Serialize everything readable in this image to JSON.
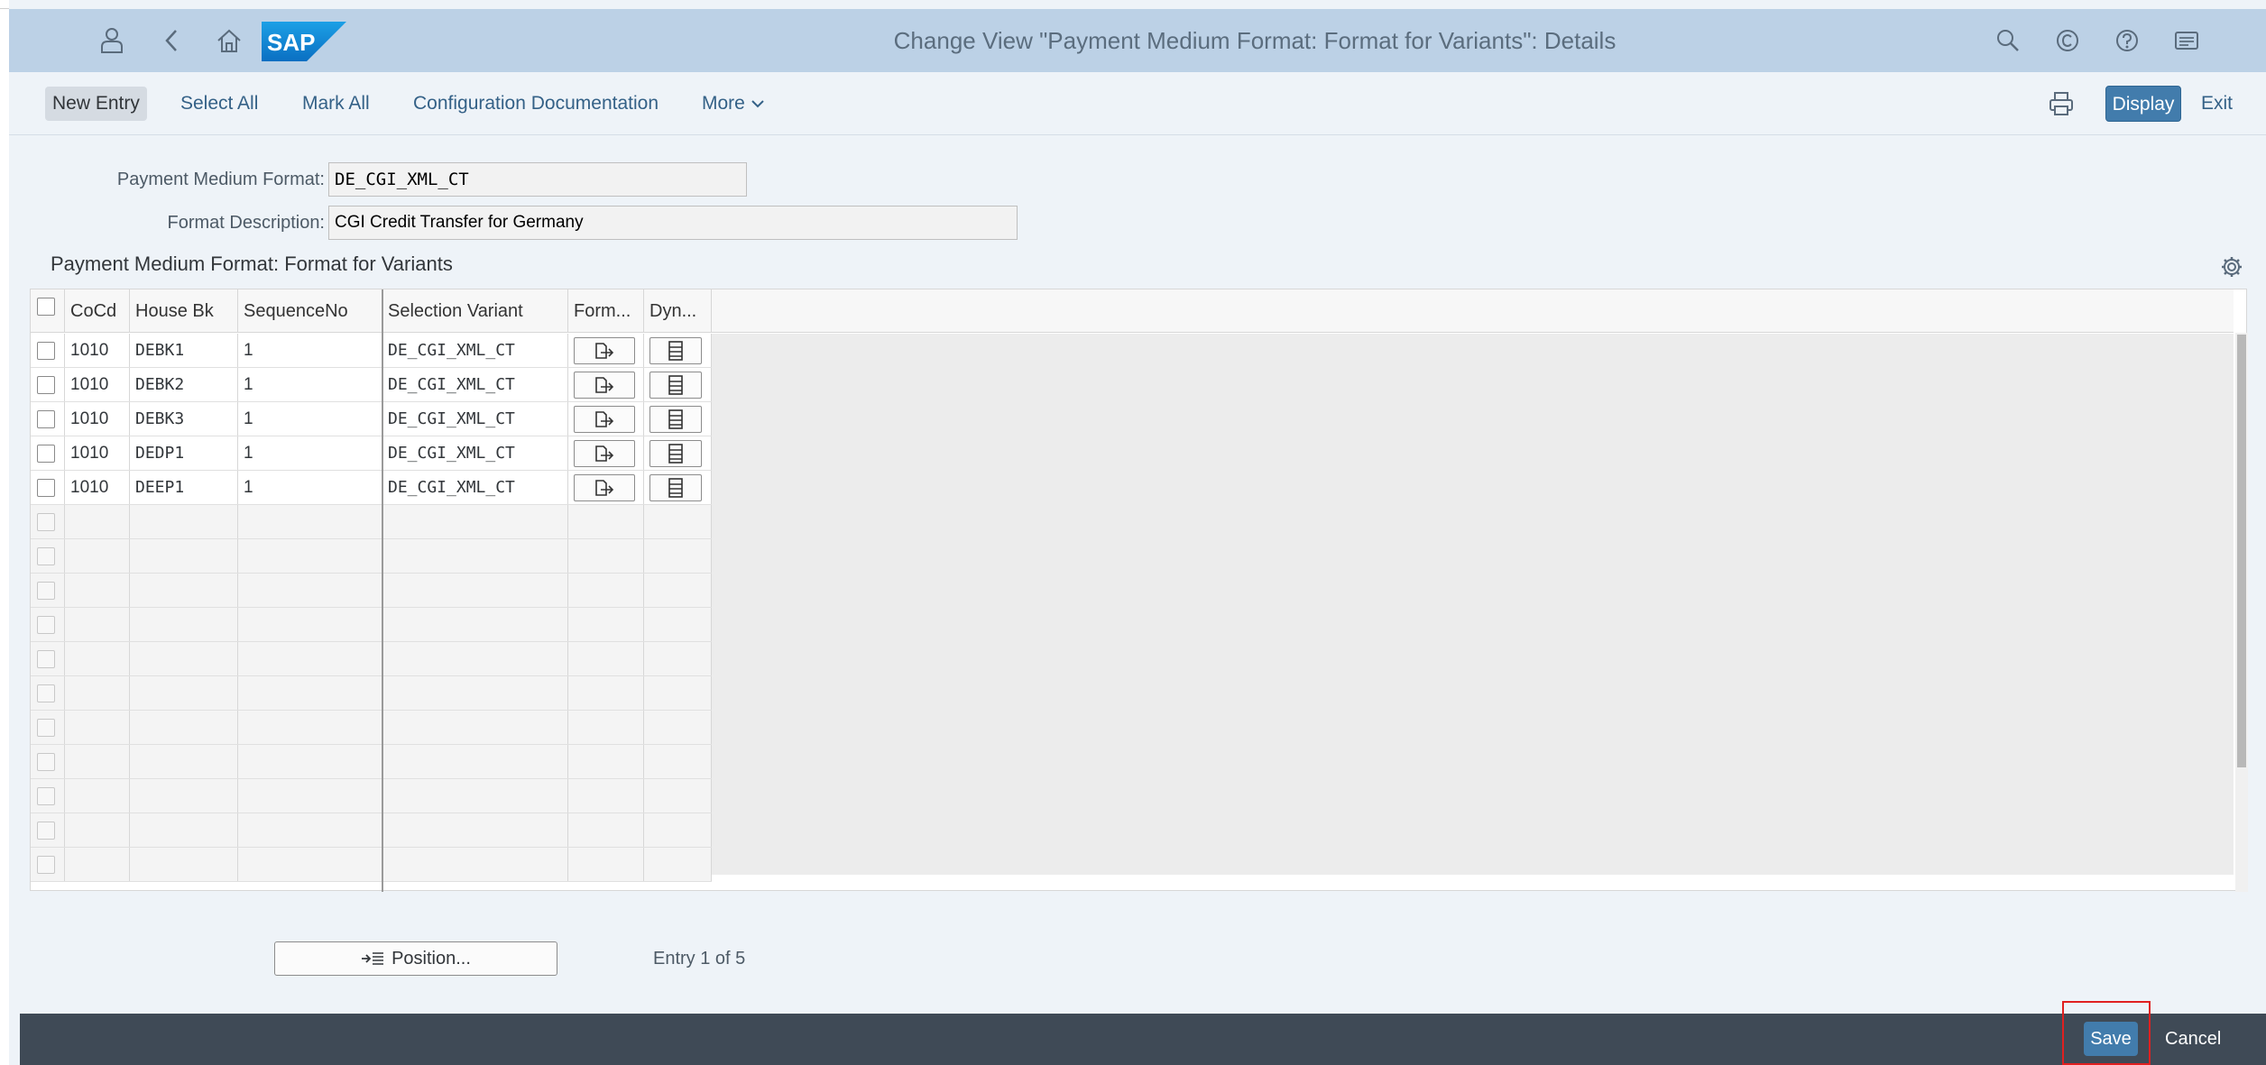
{
  "shell": {
    "title": "Change View \"Payment Medium Format: Format for Variants\": Details",
    "logo_text": "SAP",
    "icons": [
      "user-icon",
      "back-icon",
      "home-icon",
      "search-icon",
      "copyright-icon",
      "help-icon",
      "menu-icon"
    ]
  },
  "toolbar": {
    "new_entry": "New Entry",
    "select_all": "Select All",
    "mark_all": "Mark All",
    "config_doc": "Configuration Documentation",
    "more": "More",
    "display": "Display",
    "exit": "Exit"
  },
  "form": {
    "pmf_label": "Payment Medium Format:",
    "pmf_value": "DE_CGI_XML_CT",
    "desc_label": "Format Description:",
    "desc_value": "CGI Credit Transfer for Germany"
  },
  "section": {
    "title": "Payment Medium Format: Format for Variants"
  },
  "table": {
    "headers": [
      "CoCd",
      "House Bk",
      "SequenceNo",
      "Selection Variant",
      "Form...",
      "Dyn..."
    ],
    "rows": [
      {
        "cocd": "1010",
        "house_bk": "DEBK1",
        "seq": "1",
        "variant": "DE_CGI_XML_CT"
      },
      {
        "cocd": "1010",
        "house_bk": "DEBK2",
        "seq": "1",
        "variant": "DE_CGI_XML_CT"
      },
      {
        "cocd": "1010",
        "house_bk": "DEBK3",
        "seq": "1",
        "variant": "DE_CGI_XML_CT"
      },
      {
        "cocd": "1010",
        "house_bk": "DEDP1",
        "seq": "1",
        "variant": "DE_CGI_XML_CT"
      },
      {
        "cocd": "1010",
        "house_bk": "DEEP1",
        "seq": "1",
        "variant": "DE_CGI_XML_CT"
      }
    ],
    "empty_rows": 11
  },
  "footer": {
    "position_label": "Position...",
    "entry_info": "Entry 1 of 5",
    "save": "Save",
    "cancel": "Cancel"
  },
  "colors": {
    "shell_bg": "#bcd1e6",
    "accent": "#427cac",
    "footer_bg": "#3f4a56",
    "highlight": "#e02020"
  }
}
